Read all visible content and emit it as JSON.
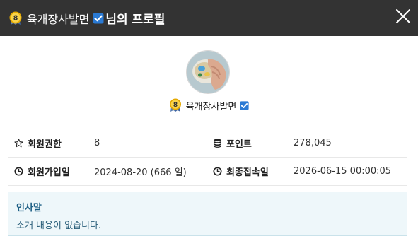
{
  "header": {
    "level_badge": "8",
    "username": "육개장사발면",
    "title_suffix": "님의 프로필",
    "close_icon": "close-icon"
  },
  "profile": {
    "level_badge": "8",
    "username": "육개장사발면"
  },
  "stats": {
    "rank_label": "회원권한",
    "rank_value": "8",
    "points_label": "포인트",
    "points_value": "278,045",
    "joined_label": "회원가입일",
    "joined_value": "2024-08-20 (666 일)",
    "last_login_label": "최종접속일",
    "last_login_value": "2026-06-15 00:00:05"
  },
  "greeting": {
    "title": "인사말",
    "body": "소개 내용이 없습니다."
  },
  "colors": {
    "header_bg": "#333333",
    "check_blue": "#2a7ad4",
    "badge_gold": "#f2b90f",
    "greeting_bg": "#eef7fa",
    "greeting_title": "#1d5f85"
  }
}
